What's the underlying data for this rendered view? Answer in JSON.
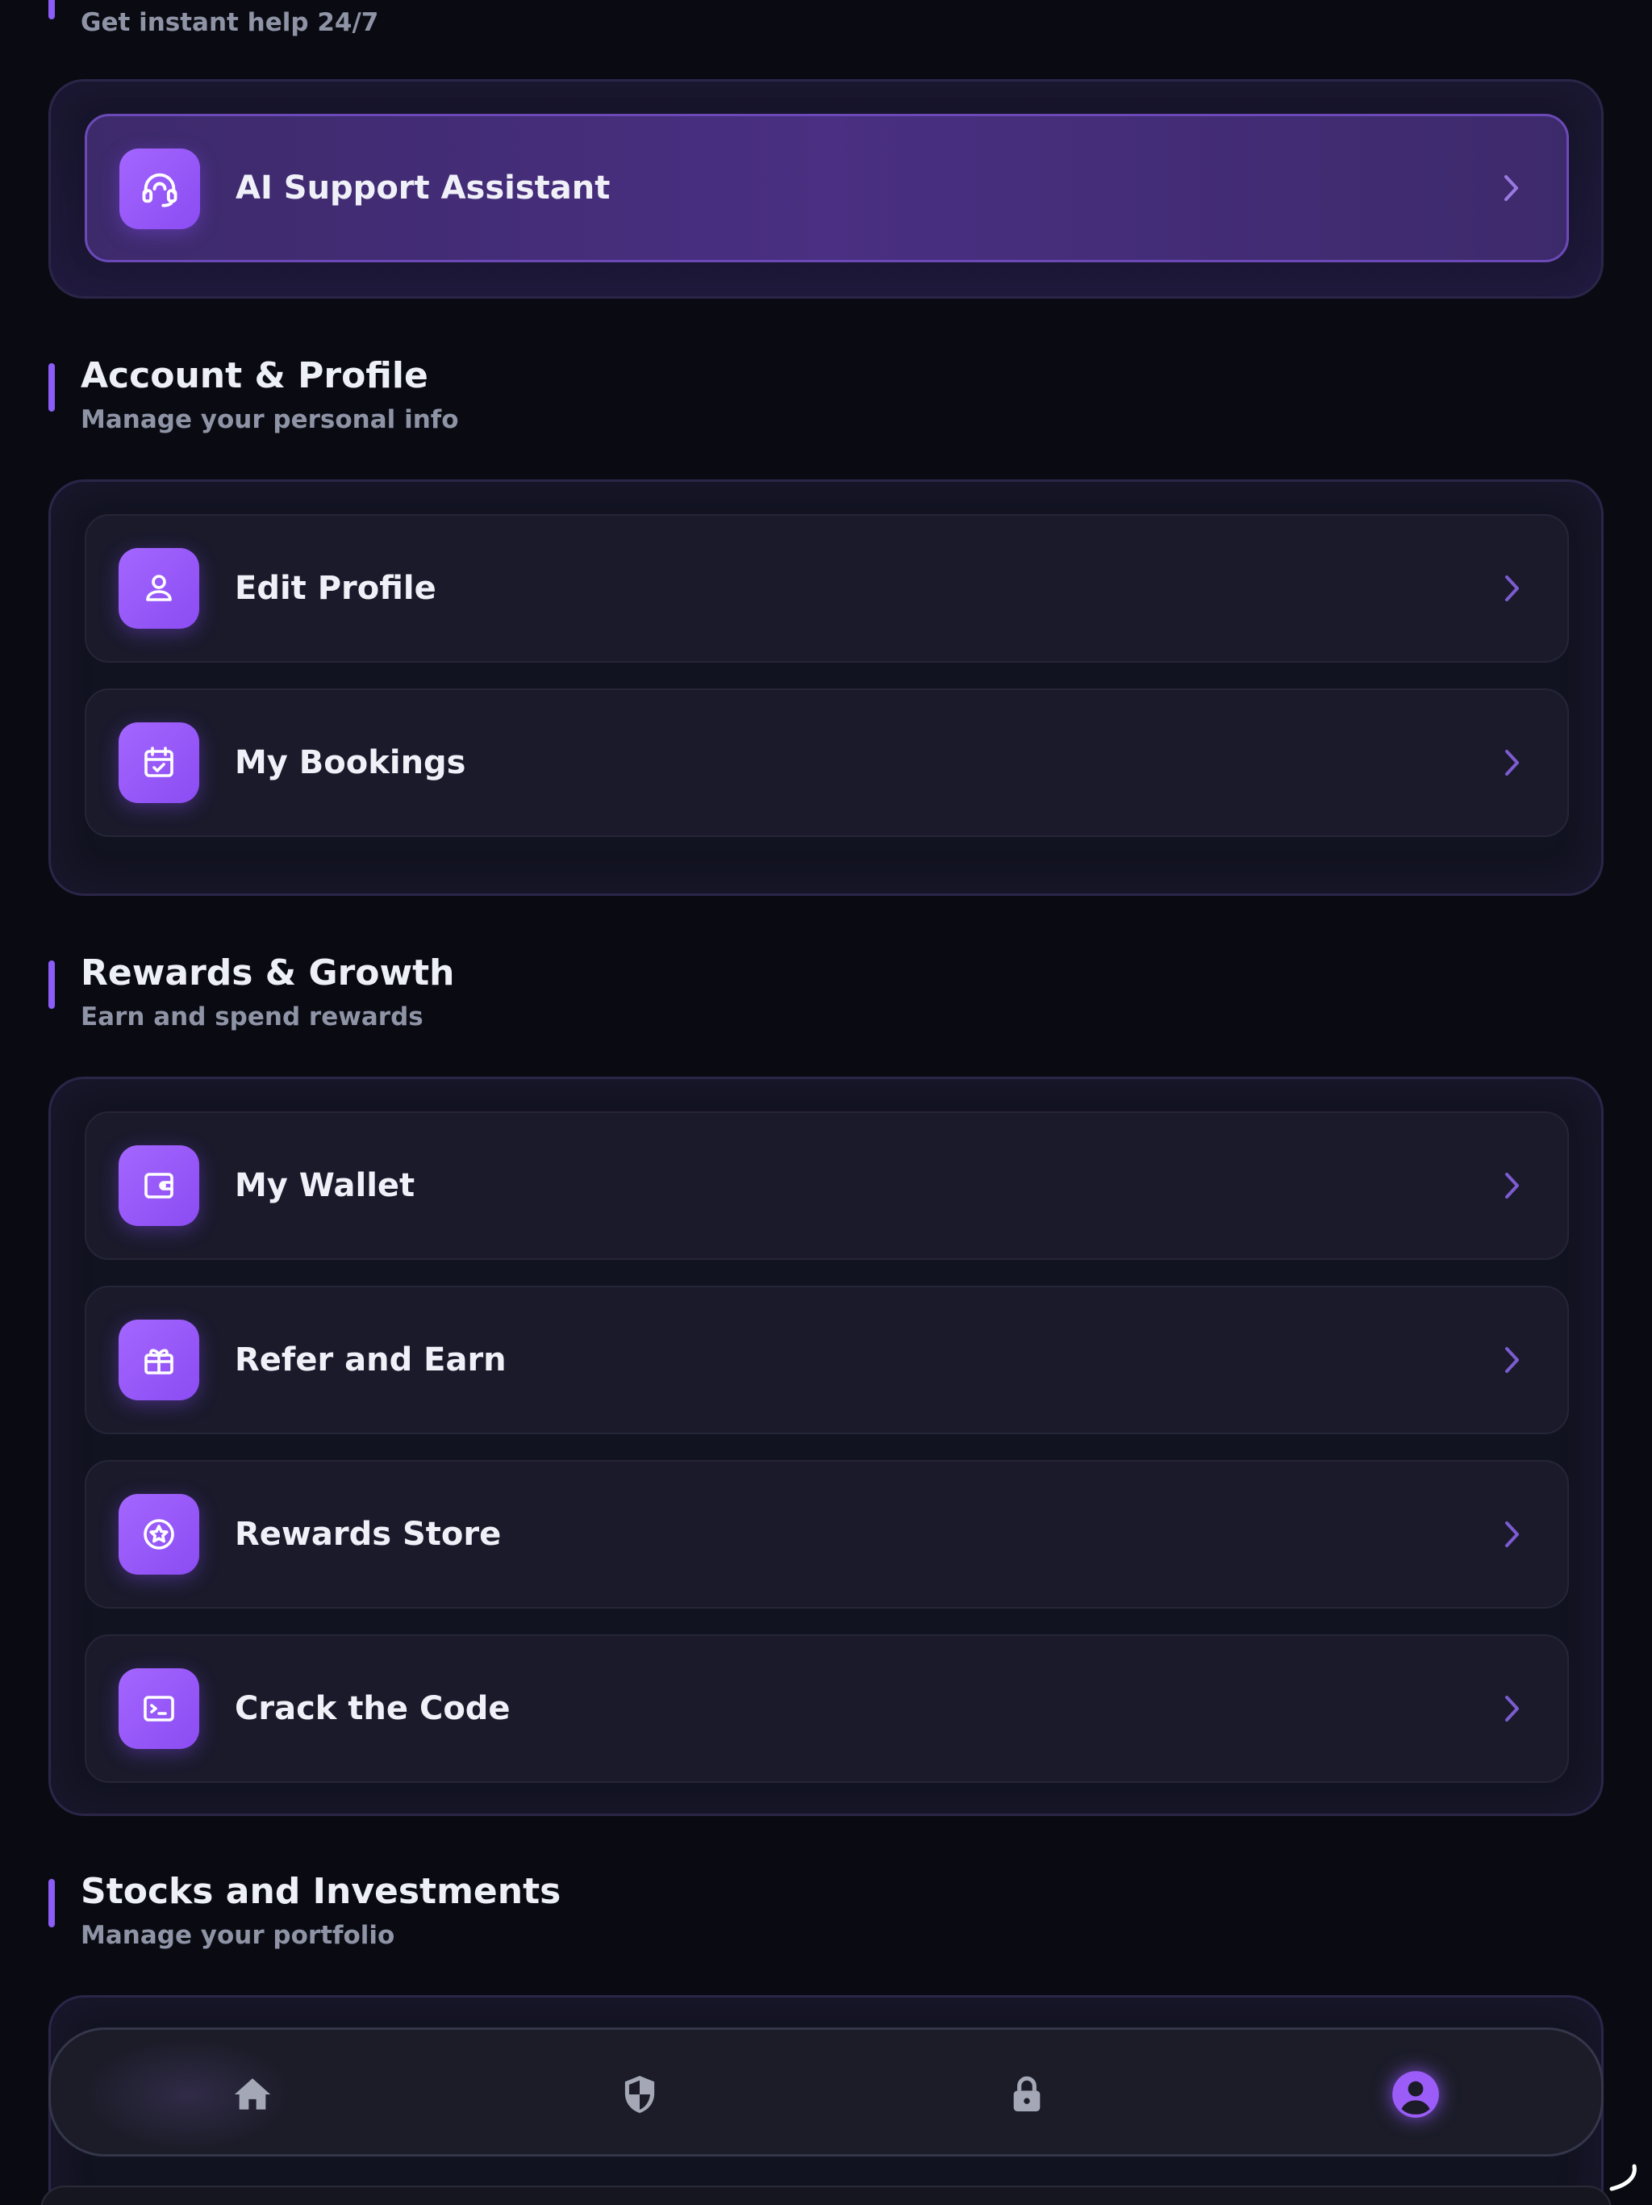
{
  "support": {
    "subtitle": "Get instant help 24/7",
    "item": {
      "label": "AI Support Assistant",
      "icon": "headset-icon"
    }
  },
  "account": {
    "title": "Account & Profile",
    "subtitle": "Manage your personal info",
    "items": [
      {
        "label": "Edit Profile",
        "icon": "user-icon"
      },
      {
        "label": "My Bookings",
        "icon": "calendar-check-icon"
      }
    ]
  },
  "rewards": {
    "title": "Rewards & Growth",
    "subtitle": "Earn and spend rewards",
    "items": [
      {
        "label": "My Wallet",
        "icon": "wallet-icon"
      },
      {
        "label": "Refer and Earn",
        "icon": "gift-icon"
      },
      {
        "label": "Rewards Store",
        "icon": "star-badge-icon"
      },
      {
        "label": "Crack the Code",
        "icon": "terminal-icon"
      }
    ]
  },
  "stocks": {
    "title": "Stocks and Investments",
    "subtitle": "Manage your portfolio"
  },
  "nav": {
    "items": [
      {
        "icon": "home-icon",
        "active": false
      },
      {
        "icon": "shield-icon",
        "active": false
      },
      {
        "icon": "lock-icon",
        "active": false
      },
      {
        "icon": "profile-icon",
        "active": true
      }
    ]
  },
  "colors": {
    "background": "#0a0b12",
    "accent": "#8b5cf6",
    "icon_tile": "#9b5cf8",
    "row": "#1a1a2b",
    "muted_text": "#8e94a6"
  }
}
